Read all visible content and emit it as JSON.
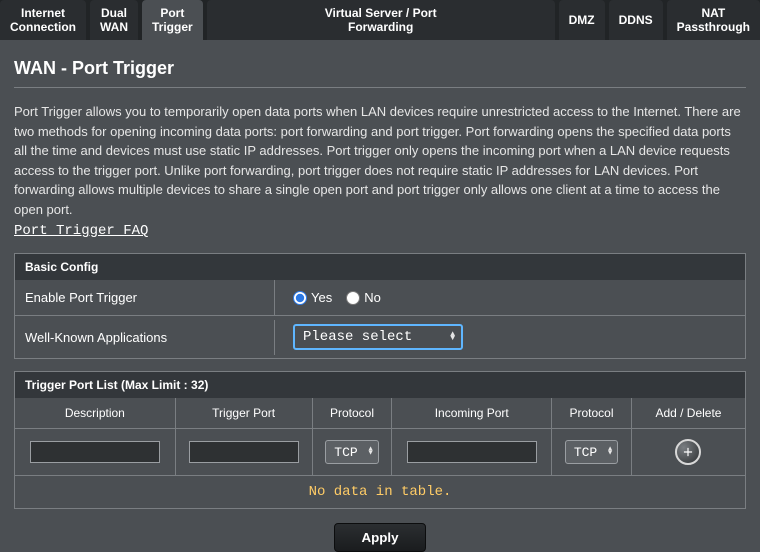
{
  "tabs": [
    "Internet\nConnection",
    "Dual\nWAN",
    "Port\nTrigger",
    "Virtual Server / Port\nForwarding",
    "DMZ",
    "DDNS",
    "NAT\nPassthrough"
  ],
  "active_tab_index": 2,
  "page_title": "WAN - Port Trigger",
  "description": "Port Trigger allows you to temporarily open data ports when LAN devices require unrestricted access to the Internet. There are two methods for opening incoming data ports: port forwarding and port trigger. Port forwarding opens the specified data ports all the time and devices must use static IP addresses. Port trigger only opens the incoming port when a LAN device requests access to the trigger port. Unlike port forwarding, port trigger does not require static IP addresses for LAN devices. Port forwarding allows multiple devices to share a single open port and port trigger only allows one client at a time to access the open port.",
  "faq_label": "Port Trigger FAQ",
  "basic_config": {
    "header": "Basic Config",
    "enable_label": "Enable Port Trigger",
    "enable_yes": "Yes",
    "enable_no": "No",
    "enable_value": "yes",
    "apps_label": "Well-Known Applications",
    "apps_select_value": "Please select"
  },
  "trigger_list": {
    "header": "Trigger Port List (Max Limit : 32)",
    "columns": {
      "description": "Description",
      "trigger_port": "Trigger Port",
      "protocol1": "Protocol",
      "incoming_port": "Incoming Port",
      "protocol2": "Protocol",
      "add_delete": "Add / Delete"
    },
    "new_row": {
      "description": "",
      "trigger_port": "",
      "protocol1": "TCP",
      "incoming_port": "",
      "protocol2": "TCP"
    },
    "empty_message": "No data in table."
  },
  "apply_label": "Apply"
}
